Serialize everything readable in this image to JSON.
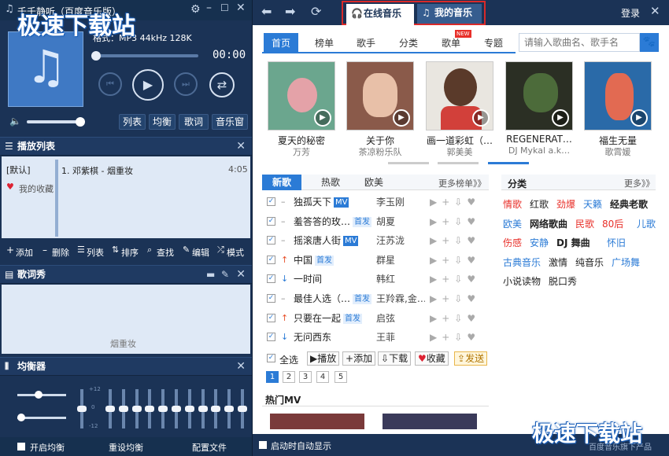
{
  "app": {
    "title": "千千静听（百度音乐版）",
    "status": "格式：MP3 44kHz 128K",
    "time": "00:00"
  },
  "player": {
    "buttons": [
      "列表",
      "均衡",
      "歌词",
      "音乐窗"
    ]
  },
  "playlist": {
    "title": "播放列表",
    "lists": [
      "[默认]",
      "我的收藏"
    ],
    "track": "1. 邓紫棋 - 烟重妆",
    "duration": "4:05",
    "toolbar": [
      "添加",
      "删除",
      "列表",
      "排序",
      "查找",
      "编辑",
      "模式"
    ]
  },
  "lyrics": {
    "title": "歌词秀",
    "text": "烟重妆"
  },
  "equalizer": {
    "title": "均衡器",
    "scale_top": "+12",
    "scale_mid": "0",
    "scale_bottom": "-12",
    "buttons": [
      "开启均衡",
      "重设均衡",
      "配置文件"
    ],
    "levels": [
      0.5,
      0.5,
      0.5,
      0.5,
      0.5,
      0.5,
      0.5,
      0.5,
      0.5,
      0.5,
      0.5
    ]
  },
  "online": {
    "tabs": {
      "online": "在线音乐",
      "mine": "我的音乐"
    },
    "login": "登录",
    "nav": [
      "首页",
      "榜单",
      "歌手",
      "分类",
      "歌单",
      "专题"
    ],
    "new_badge": "NEW",
    "search_placeholder": "请输入歌曲名、歌手名",
    "albums": [
      {
        "title": "夏天的秘密",
        "artist": "万芳"
      },
      {
        "title": "关于你",
        "artist": "茶凉粉乐队"
      },
      {
        "title": "画一道彩虹（…",
        "artist": "郭美美"
      },
      {
        "title": "REGENERAT…",
        "artist": "DJ Mykal a.k…"
      },
      {
        "title": "福生无量",
        "artist": "歌霄媛"
      }
    ],
    "song_tabs": [
      "新歌",
      "热歌",
      "欧美"
    ],
    "more_charts": "更多榜单》》",
    "songs": [
      {
        "name": "独孤天下",
        "tag": "MV",
        "artist": "李玉刚",
        "mark": "–"
      },
      {
        "name": "羞答答的玫…",
        "tag": "首发",
        "artist": "胡夏",
        "mark": "–"
      },
      {
        "name": "摇滚唐人街",
        "tag": "MV",
        "artist": "汪苏泷",
        "mark": "–"
      },
      {
        "name": "中国",
        "tag": "首发",
        "artist": "群星",
        "mark": "↑"
      },
      {
        "name": "一时间",
        "tag": "",
        "artist": "韩红",
        "mark": "↓"
      },
      {
        "name": "最佳人选（…",
        "tag": "首发",
        "artist": "王羚霖,金…",
        "mark": "–"
      },
      {
        "name": "只要在一起",
        "tag": "首发",
        "artist": "启弦",
        "mark": "↑"
      },
      {
        "name": "无问西东",
        "tag": "",
        "artist": "王菲",
        "mark": "↓"
      }
    ],
    "bottom_actions": [
      "全选",
      "播放",
      "添加",
      "下载",
      "收藏",
      "发送"
    ],
    "pages": [
      "1",
      "2",
      "3",
      "4",
      "5"
    ],
    "hot_mv": "热门MV",
    "categories_title": "分类",
    "more": "更多》》",
    "categories": [
      [
        "情歌",
        "红歌",
        "劲爆",
        "天籁",
        "经典老歌"
      ],
      [
        "欧美",
        "网络歌曲",
        "民歌",
        "80后",
        "儿歌"
      ],
      [
        "伤感",
        "安静",
        "DJ 舞曲",
        "怀旧"
      ],
      [
        "古典音乐",
        "激情",
        "纯音乐",
        "广场舞"
      ],
      [
        "小说读物",
        "脱口秀"
      ]
    ],
    "autostart": "启动时自动显示",
    "footer": "百度音乐旗下产品"
  },
  "watermark": "极速下载站"
}
